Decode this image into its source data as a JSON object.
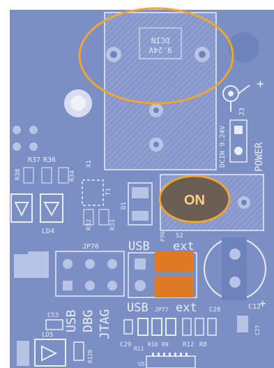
{
  "colors": {
    "board": "#7c8fc4",
    "board_dark": "#6e82bb",
    "silkscreen": "#e9edf7",
    "copper_pad": "#b7c4e6",
    "highlight_ellipse": "#f0a630",
    "on_badge_fill": "#6b5f55",
    "on_badge_text": "#ffcf86",
    "jumper_cap": "#e07a22"
  },
  "silkscreen": {
    "dcin_top": "DCIN",
    "dcin_voltage": "9.24V",
    "plus_sign": "+",
    "j3": "J3",
    "dcin_side": "DCIN 9.24V",
    "power": "POWER",
    "r37": "R37",
    "r36": "R36",
    "r38": "R38",
    "r34": "R34",
    "x1": "X1",
    "t1": "T1",
    "r32": "R32",
    "r31": "R31",
    "d1": "D1",
    "ld4": "LD4",
    "jp76": "JP76",
    "p76": "P76",
    "s2": "S2",
    "usb_top": "USB",
    "ext_top": "ext",
    "usb_bottom": "USB",
    "jp77": "JP77",
    "ext_bottom": "ext",
    "c28": "C28",
    "c12": "C12",
    "c27": "C27",
    "usb_debug_usb": "USB",
    "usb_debug_dbg": "DBG",
    "usb_debug_jtag": "JTAG",
    "cs3": "CS3",
    "ld5": "LD5",
    "r128": "R128",
    "c29": "C29",
    "r11": "R11",
    "r10": "R10",
    "r9": "R9",
    "r12": "R12",
    "r8": "R8",
    "u5": "U5"
  },
  "callout": {
    "on_label": "ON"
  }
}
